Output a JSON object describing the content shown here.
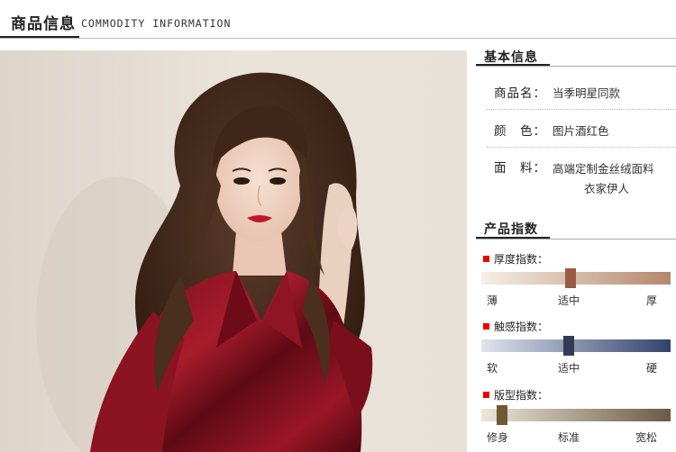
{
  "header": {
    "title": "商品信息",
    "subtitle": "COMMODITY INFORMATION"
  },
  "basic_info": {
    "title": "基本信息",
    "rows": [
      {
        "label": "商品名：",
        "value": "当季明星同款"
      },
      {
        "label": "颜　色：",
        "value": "图片酒红色"
      },
      {
        "label": "面　料：",
        "value": "高端定制金丝绒面料",
        "value2": "衣家伊人"
      }
    ]
  },
  "product_index": {
    "title": "产品指数",
    "indexes": [
      {
        "label": "厚度指数：",
        "ticks": [
          "薄",
          "适中",
          "厚"
        ],
        "level": 0.47,
        "bar_start": "#f6efe8",
        "bar_end": "#b4876b",
        "knob_color": "#9b5a46"
      },
      {
        "label": "触感指数：",
        "ticks": [
          "软",
          "适中",
          "硬"
        ],
        "level": 0.46,
        "bar_start": "#dfe4ee",
        "bar_end": "#32426d",
        "knob_color": "#333a55"
      },
      {
        "label": "版型指数：",
        "ticks": [
          "修身",
          "标准",
          "宽松"
        ],
        "level": 0.08,
        "bar_start": "#eee6da",
        "bar_end": "#6b5a45",
        "knob_color": "#6d5a33"
      }
    ]
  },
  "photo": {
    "subject": "model-wearing-wine-red-velvet-blazer"
  }
}
